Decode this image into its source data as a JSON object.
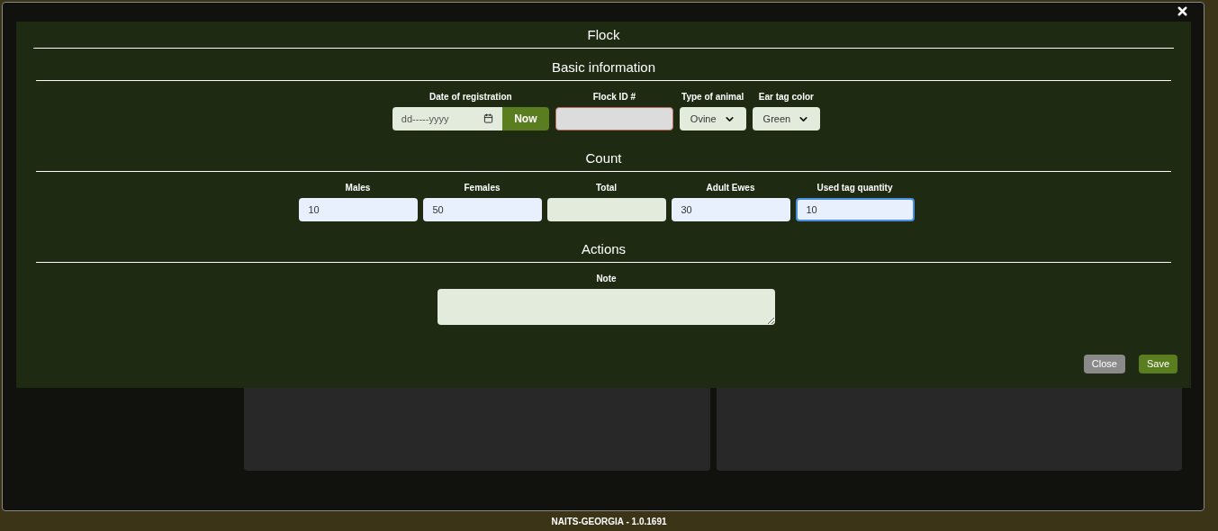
{
  "modal": {
    "title": "Flock",
    "sections": [
      {
        "title": "Basic information",
        "kind": "basic",
        "fields": [
          {
            "kind": "date",
            "label": "Date of registration",
            "placeholder": "dd-----yyyy",
            "button": "Now"
          },
          {
            "kind": "text",
            "label": "Flock ID #",
            "disabled": true
          },
          {
            "kind": "select",
            "label": "Type of animal",
            "value": "Ovine"
          },
          {
            "kind": "select",
            "label": "Ear tag color",
            "value": "Green"
          }
        ]
      },
      {
        "title": "Count",
        "kind": "count",
        "fields": [
          {
            "kind": "number",
            "label": "Males",
            "value": "10",
            "focused": false
          },
          {
            "kind": "number",
            "label": "Females",
            "value": "50",
            "focused": false
          },
          {
            "kind": "number",
            "label": "Total",
            "focused": false
          },
          {
            "kind": "number",
            "label": "Adult Ewes",
            "value": "30",
            "focused": false
          },
          {
            "kind": "number",
            "label": "Used tag quantity",
            "value": "10",
            "focused": true
          }
        ]
      },
      {
        "title": "Actions",
        "kind": "actions",
        "fields": [
          {
            "kind": "textarea",
            "label": "Note"
          }
        ]
      }
    ],
    "buttons": [
      {
        "label": "Close",
        "kind": "secondary"
      },
      {
        "label": "Save",
        "kind": "primary"
      }
    ]
  },
  "footer": "NAITS-GEORGIA - 1.0.1691"
}
